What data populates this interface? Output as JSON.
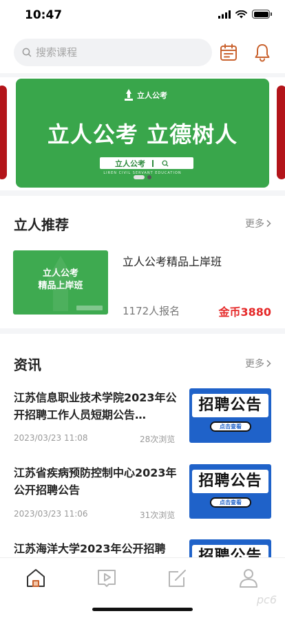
{
  "status_bar": {
    "time": "10:47"
  },
  "search": {
    "placeholder": "搜索课程"
  },
  "banner": {
    "logo_text": "立人公考",
    "slogan": "立人公考  立德树人",
    "search_text": "立人公考",
    "subtitle": "LIREN CIVIL SERVANT EDUCATION",
    "active_dot": 1
  },
  "recommend": {
    "title": "立人推荐",
    "more": "更多",
    "course": {
      "thumb_title": "立人公考\n精品上岸班",
      "name": "立人公考精品上岸班",
      "enrolled": "1172人报名",
      "price": "金币3880"
    }
  },
  "news": {
    "title": "资讯",
    "more": "更多",
    "items": [
      {
        "title": "江苏信息职业技术学院2023年公开招聘工作人员短期公告…",
        "date": "2023/03/23 11:08",
        "views": "28次浏览",
        "thumb_text": "招聘公告",
        "thumb_button": "点击查看"
      },
      {
        "title": "江苏省疾病预防控制中心2023年公开招聘公告",
        "date": "2023/03/23 11:06",
        "views": "31次浏览",
        "thumb_text": "招聘公告",
        "thumb_button": "点击查看"
      },
      {
        "title": "江苏海洋大学2023年公开招聘",
        "date": "",
        "views": "",
        "thumb_text": "招聘公告",
        "thumb_button": ""
      }
    ]
  },
  "tab_bar": {
    "tabs": [
      {
        "icon": "home-icon",
        "active": true
      },
      {
        "icon": "video-icon",
        "active": false
      },
      {
        "icon": "edit-icon",
        "active": false
      },
      {
        "icon": "profile-icon",
        "active": false
      }
    ],
    "active_color": "#c9622e",
    "inactive_color": "#b5b5b5"
  },
  "watermark": "pc6",
  "colors": {
    "brand_green": "#39a64b",
    "price_red": "#e52828",
    "accent_orange": "#c9622e"
  }
}
